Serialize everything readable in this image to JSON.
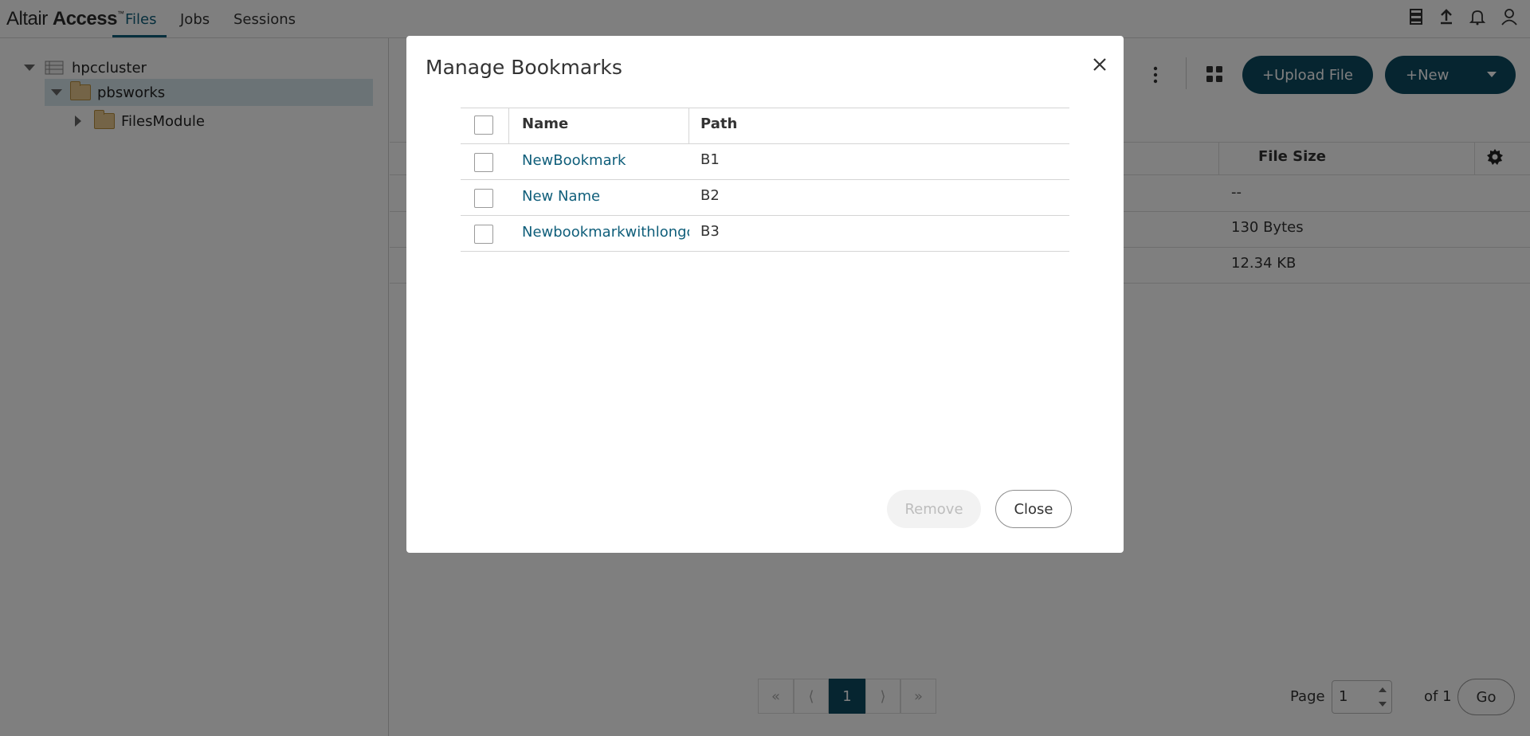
{
  "app": {
    "brand_name": "Altair",
    "brand_product": "Access",
    "brand_tm": "™"
  },
  "nav": {
    "tabs": [
      {
        "label": "Files",
        "active": true
      },
      {
        "label": "Jobs",
        "active": false
      },
      {
        "label": "Sessions",
        "active": false
      }
    ],
    "icons": [
      "server-icon",
      "upload-icon",
      "bell-icon",
      "user-icon"
    ]
  },
  "tree": {
    "items": [
      {
        "label": "hpccluster",
        "icon": "server-icon",
        "expanded": true
      },
      {
        "label": "pbsworks",
        "icon": "folder-icon",
        "expanded": true,
        "selected": true
      },
      {
        "label": "FilesModule",
        "icon": "folder-icon",
        "expanded": false
      }
    ]
  },
  "toolbar": {
    "upload_label": "+Upload File",
    "new_label": "+New"
  },
  "files_table": {
    "headers": [
      "File Size"
    ],
    "rows": [
      {
        "size": "--"
      },
      {
        "size": "130 Bytes"
      },
      {
        "size": "12.34 KB"
      }
    ]
  },
  "pager": {
    "first": "«",
    "prev": "⟨",
    "current": "1",
    "next": "⟩",
    "last": "»",
    "page_label": "Page",
    "page_value": "1",
    "of_label": "of 1",
    "go_label": "Go"
  },
  "modal": {
    "title": "Manage Bookmarks",
    "headers": {
      "name": "Name",
      "path": "Path"
    },
    "rows": [
      {
        "name": "NewBookmark",
        "path": "B1"
      },
      {
        "name": "New Name",
        "path": "B2"
      },
      {
        "name": "Newbookmarkwithlongcl",
        "path": "B3"
      }
    ],
    "remove_label": "Remove",
    "close_label": "Close"
  },
  "colors": {
    "accent": "#0d4a60",
    "link": "#0f5e7a",
    "selected_row": "#d7e6ec"
  }
}
